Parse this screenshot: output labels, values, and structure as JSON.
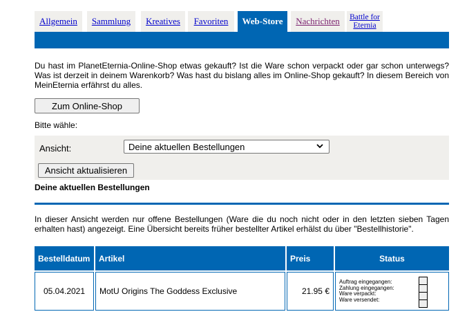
{
  "tabs": [
    {
      "label": "Allgemein",
      "active": false
    },
    {
      "label": "Sammlung",
      "active": false
    },
    {
      "label": "Kreatives",
      "active": false
    },
    {
      "label": "Favoriten",
      "active": false
    },
    {
      "label": "Web-Store",
      "active": true
    },
    {
      "label": "Nachrichten",
      "active": false
    },
    {
      "label_line1": "Battle for",
      "label_line2": "Eternia",
      "active": false
    }
  ],
  "intro_text": "Du hast im PlanetEternia-Online-Shop etwas gekauft? Ist die Ware schon verpackt oder gar schon unterwegs? Was ist derzeit in deinem Warenkorb? Was hast du bislang alles im Online-Shop gekauft? In diesem Bereich von MeinEternia erfährst du alles.",
  "shop_button": "Zum Online-Shop",
  "choose_label": "Bitte wähle:",
  "view_label": "Ansicht:",
  "view_select_value": "Deine aktuellen Bestellungen",
  "update_button": "Ansicht aktualisieren",
  "section_title": "Deine aktuellen Bestellungen",
  "description": "In dieser Ansicht werden nur offene Bestellungen (Ware die du noch nicht oder in den letzten sieben Tagen erhalten hast) angezeigt. Eine Übersicht bereits früher bestellter Artikel erhälst du über \"Bestellhistorie\".",
  "table": {
    "headers": {
      "date": "Bestelldatum",
      "item": "Artikel",
      "price": "Preis",
      "status": "Status"
    },
    "rows": [
      {
        "date": "05.04.2021",
        "item": "MotU Origins The Goddess Exclusive",
        "price": "21.95 €",
        "status_lines": [
          "Auftrag eingegangen:",
          "Zahlung eingegangen:",
          "Ware verpackt:",
          "Ware versendet:"
        ]
      }
    ]
  },
  "colors": {
    "accent": "#0066b3",
    "panel": "#f0efec",
    "link": "#0000cc",
    "visited_link": "#7a1f6e"
  }
}
